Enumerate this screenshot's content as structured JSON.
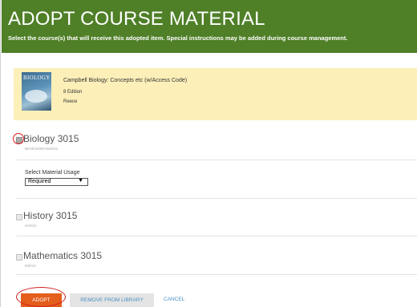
{
  "header": {
    "title": "ADOPT COURSE MATERIAL",
    "subtitle": "Select the course(s) that will receive this adopted item. Special instructions may be added during course management.",
    "background": "#4f7f27"
  },
  "item": {
    "cover_text": "BIOLOGY",
    "title": "Campbell Biology: Concepts etc (w/Access Code)",
    "edition": "8 Edition",
    "author": "Reece",
    "card_color": "#fcefb8"
  },
  "courses": [
    {
      "name": "Biology 3015",
      "code": "BIO3015/BIOW3015",
      "checked": true
    },
    {
      "name": "History 3015",
      "code": "HI3015",
      "checked": false
    },
    {
      "name": "Mathematics 3015",
      "code": "M3015",
      "checked": false
    }
  ],
  "usage": {
    "label": "Select Material Usage",
    "selected": "Required",
    "arrow": "▼"
  },
  "actions": {
    "adopt": "ADOPT",
    "remove": "REMOVE FROM LIBRARY",
    "cancel": "CANCEL",
    "adopt_color": "#e45e1c",
    "link_color": "#4a90c2"
  }
}
